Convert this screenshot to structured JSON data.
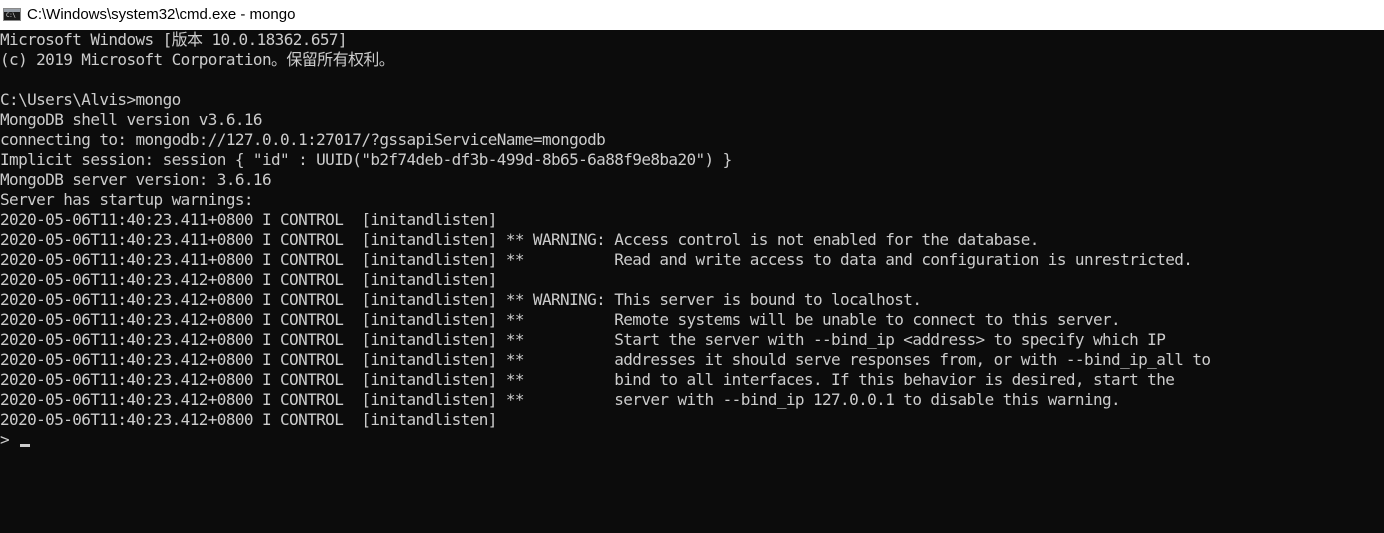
{
  "window": {
    "title": "C:\\Windows\\system32\\cmd.exe - mongo",
    "icon": "cmd-console-icon",
    "icon_prompt": "C:\\"
  },
  "colors": {
    "background": "#0c0c0c",
    "text": "#cccccc",
    "titlebar": "#ffffff"
  },
  "console": {
    "lines": [
      "Microsoft Windows [版本 10.0.18362.657]",
      "(c) 2019 Microsoft Corporation。保留所有权利。",
      "",
      "C:\\Users\\Alvis>mongo",
      "MongoDB shell version v3.6.16",
      "connecting to: mongodb://127.0.0.1:27017/?gssapiServiceName=mongodb",
      "Implicit session: session { \"id\" : UUID(\"b2f74deb-df3b-499d-8b65-6a88f9e8ba20\") }",
      "MongoDB server version: 3.6.16",
      "Server has startup warnings:",
      "2020-05-06T11:40:23.411+0800 I CONTROL  [initandlisten]",
      "2020-05-06T11:40:23.411+0800 I CONTROL  [initandlisten] ** WARNING: Access control is not enabled for the database.",
      "2020-05-06T11:40:23.411+0800 I CONTROL  [initandlisten] **          Read and write access to data and configuration is unrestricted.",
      "2020-05-06T11:40:23.412+0800 I CONTROL  [initandlisten]",
      "2020-05-06T11:40:23.412+0800 I CONTROL  [initandlisten] ** WARNING: This server is bound to localhost.",
      "2020-05-06T11:40:23.412+0800 I CONTROL  [initandlisten] **          Remote systems will be unable to connect to this server.",
      "2020-05-06T11:40:23.412+0800 I CONTROL  [initandlisten] **          Start the server with --bind_ip <address> to specify which IP",
      "2020-05-06T11:40:23.412+0800 I CONTROL  [initandlisten] **          addresses it should serve responses from, or with --bind_ip_all to",
      "2020-05-06T11:40:23.412+0800 I CONTROL  [initandlisten] **          bind to all interfaces. If this behavior is desired, start the",
      "2020-05-06T11:40:23.412+0800 I CONTROL  [initandlisten] **          server with --bind_ip 127.0.0.1 to disable this warning.",
      "2020-05-06T11:40:23.412+0800 I CONTROL  [initandlisten]"
    ],
    "prompt": ">"
  }
}
